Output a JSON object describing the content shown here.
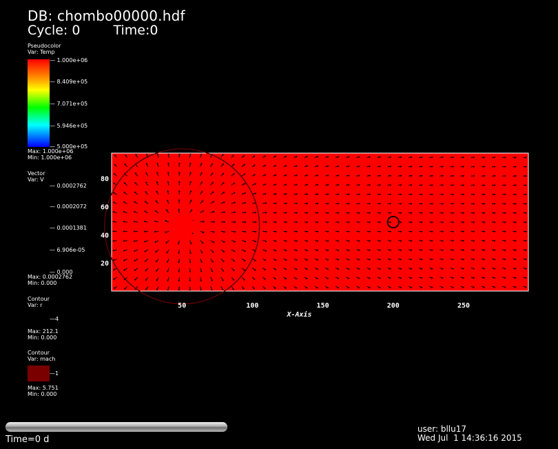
{
  "header": {
    "db_label": "DB: chombo00000.hdf",
    "cycle_label": "Cycle: 0",
    "time_label": "Time:0"
  },
  "legends": {
    "pseudocolor": {
      "title": "Pseudocolor",
      "var": "Var: Temp",
      "ticks": [
        "1.000e+06",
        "8.409e+05",
        "7.071e+05",
        "5.946e+05",
        "5.000e+05"
      ],
      "max": "Max:  1.000e+06",
      "min": "Min:  1.000e+06"
    },
    "vector": {
      "title": "Vector",
      "var": "Var: V",
      "ticks": [
        "0.0002762",
        "0.0002072",
        "0.0001381",
        "6.906e-05",
        "0.000"
      ],
      "max": "Max:  0.0002762",
      "min": "Min:  0.000"
    },
    "contour_r": {
      "title": "Contour",
      "var": "Var: r",
      "level": "4",
      "max": "Max:  212.1",
      "min": "Min:  0.000"
    },
    "contour_mach": {
      "title": "Contour",
      "var": "Var: mach",
      "level": "1",
      "max": "Max:  5.751",
      "min": "Min:  0.000",
      "swatch_color": "#7a0000"
    }
  },
  "plot": {
    "fill_color": "#ff0000",
    "arrow_color": "#000000",
    "xlabel": "X-Axis",
    "x_ticks": [
      "50",
      "100",
      "150",
      "200",
      "250"
    ],
    "y_ticks": [
      "20",
      "40",
      "60",
      "80"
    ]
  },
  "chart_data": {
    "type": "heatmap",
    "xlabel": "X-Axis",
    "ylabel": "",
    "xlim": [
      0,
      296
    ],
    "ylim": [
      0,
      98
    ],
    "x_ticks": [
      50,
      100,
      150,
      200,
      250
    ],
    "y_ticks": [
      20,
      40,
      60,
      80
    ],
    "field": "Temp",
    "field_value": 1000000,
    "colorbar_range": [
      500000,
      1000000
    ],
    "vector_source": {
      "x": 50,
      "y": 46
    },
    "contour_r": {
      "level": 4,
      "center": [
        50,
        46
      ],
      "radius": 4
    },
    "contour_circle": {
      "center": [
        50,
        46
      ],
      "radius": 55
    },
    "contour_mach": {
      "level": 1,
      "center": [
        200,
        49
      ],
      "radius": 4
    }
  },
  "footer": {
    "time_readout": "Time=0 d",
    "user": "user: bllu17",
    "date": "Wed Jul  1 14:36:16 2015"
  }
}
